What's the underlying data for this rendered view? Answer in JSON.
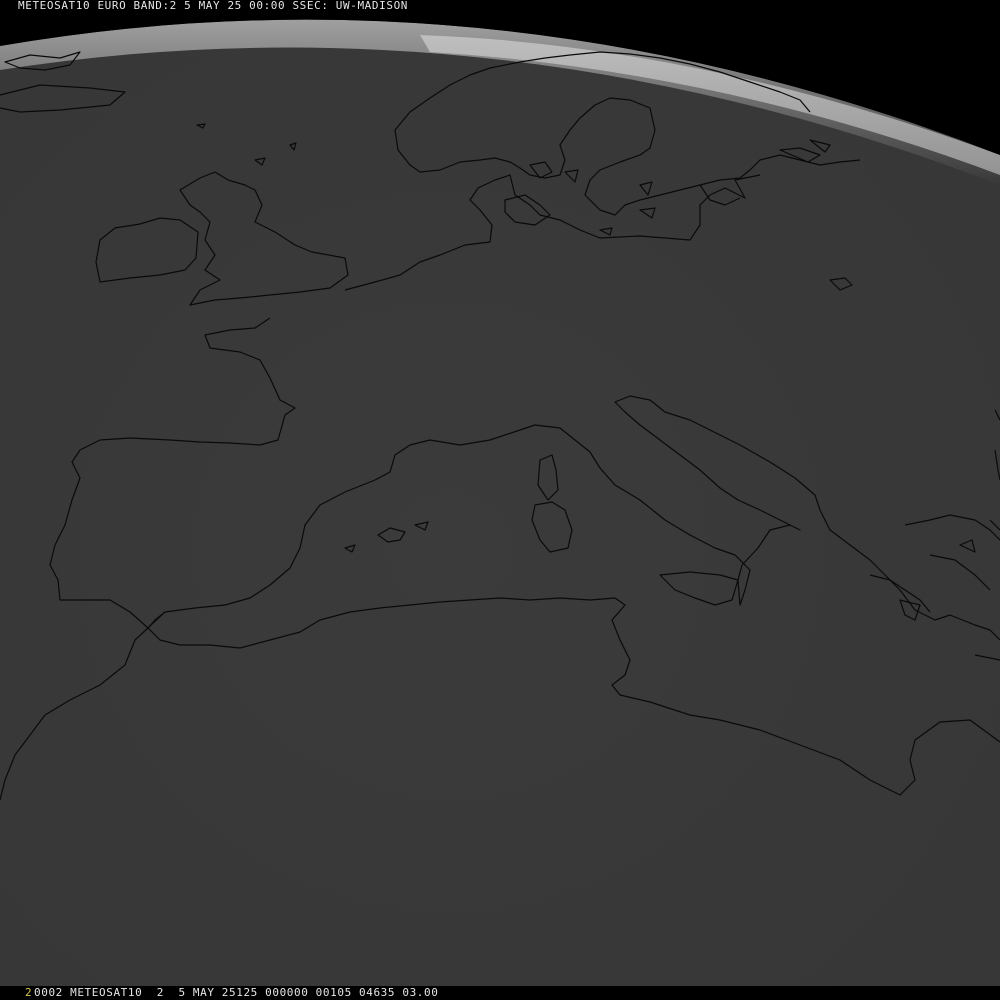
{
  "header": {
    "title": "METEOSAT10 EURO BAND:2 5 MAY 25 00:00 SSEC: UW-MADISON"
  },
  "footer": {
    "frame_number": "2",
    "info": "0002 METEOSAT10  2  5 MAY 25125 000000 00105 04635 03.00"
  },
  "colors": {
    "background": "#000000",
    "earth_disk": "#3a3a3a",
    "limb_glow": "#f2f2f2",
    "coastline": "#0a0a0a",
    "text": "#e6e6e6",
    "frame_number_text": "#d8c64a"
  }
}
